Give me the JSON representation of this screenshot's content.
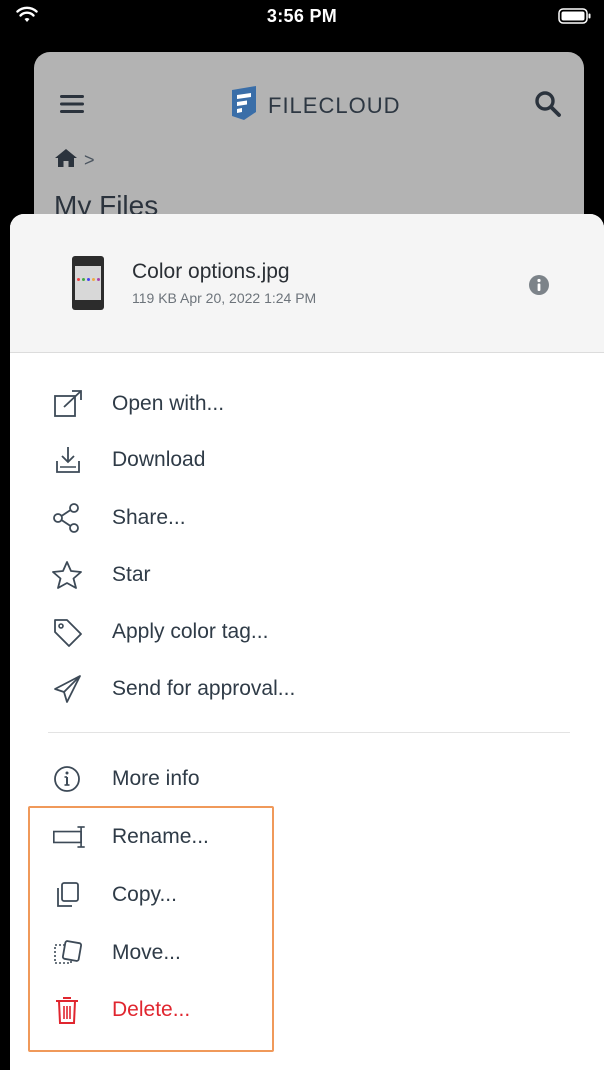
{
  "status_bar": {
    "time": "3:56 PM",
    "wifi_icon": "wifi-icon",
    "battery_icon": "battery-icon"
  },
  "app_header": {
    "menu_icon": "hamburger-menu-icon",
    "logo_text": "FILECLOUD",
    "search_icon": "search-icon",
    "breadcrumb_home_icon": "home-icon",
    "breadcrumb_separator": ">",
    "page_title": "My Files"
  },
  "file": {
    "name": "Color options.jpg",
    "meta": "119 KB Apr 20, 2022 1:24 PM",
    "info_icon": "info-icon"
  },
  "actions": [
    {
      "label": "Open with...",
      "icon": "open-external-icon"
    },
    {
      "label": "Download",
      "icon": "download-icon"
    },
    {
      "label": "Share...",
      "icon": "share-icon"
    },
    {
      "label": "Star",
      "icon": "star-icon"
    },
    {
      "label": "Apply color tag...",
      "icon": "tag-icon"
    },
    {
      "label": "Send for approval...",
      "icon": "send-icon"
    }
  ],
  "more_actions": [
    {
      "label": "More info",
      "icon": "info-circle-icon"
    },
    {
      "label": "Rename...",
      "icon": "rename-icon"
    },
    {
      "label": "Copy...",
      "icon": "copy-icon"
    },
    {
      "label": "Move...",
      "icon": "move-icon"
    },
    {
      "label": "Delete...",
      "icon": "trash-icon"
    }
  ],
  "colors": {
    "accent_highlight": "#f0995a",
    "delete": "#e0262f",
    "text": "#2f3b47"
  }
}
